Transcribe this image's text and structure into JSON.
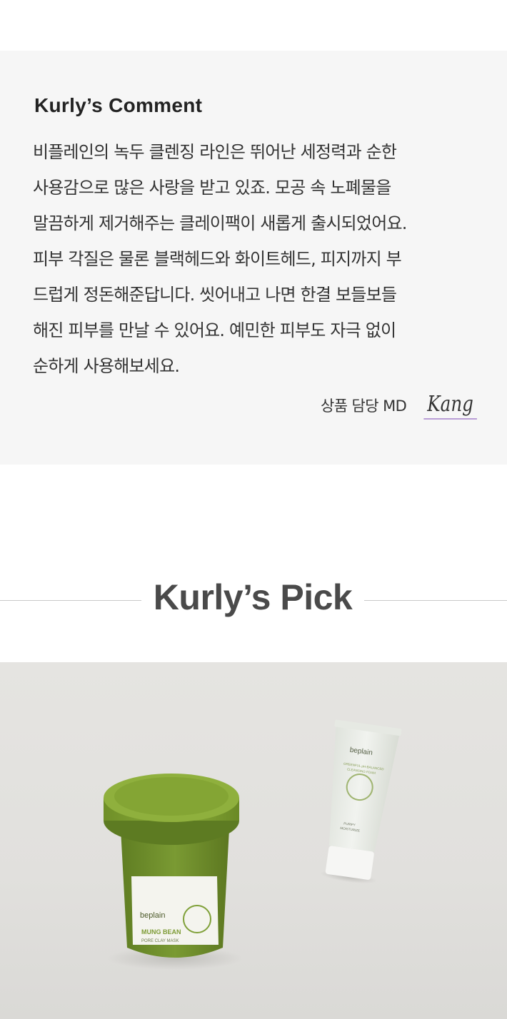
{
  "comment": {
    "title": "Kurly’s Comment",
    "lines": [
      "비플레인의 녹두 클렌징 라인은 뛰어난 세정력과 순한",
      "사용감으로 많은 사랑을 받고 있죠. 모공 속 노폐물을",
      "말끔하게 제거해주는 클레이팩이 새롭게 출시되었어요.",
      "피부 각질은 물론 블랙헤드와 화이트헤드, 피지까지 부",
      "드럽게 정돈해준답니다. 씻어내고 나면 한결 보들보들",
      "해진 피부를 만날 수 있어요. 예민한 피부도 자극 없이",
      "순하게 사용해보세요."
    ],
    "md_label": "상품 담당 MD",
    "md_name": "Kang"
  },
  "pick": {
    "title": "Kurly’s Pick"
  },
  "product_photo": {
    "jar": {
      "brand": "beplain",
      "name": "MUNG BEAN",
      "subtitle": "PORE CLAY MASK"
    },
    "tube": {
      "brand": "beplain",
      "name_line1": "GREENFUL pH-BALANCED",
      "name_line2": "CLEANSING FOAM",
      "sub_line1": "PURIFY",
      "sub_line2": "MOISTURIZE"
    },
    "colors": {
      "jar_green": "#6f8e2b",
      "lid_green": "#86a832",
      "tube_body": "#e9ece6"
    }
  }
}
